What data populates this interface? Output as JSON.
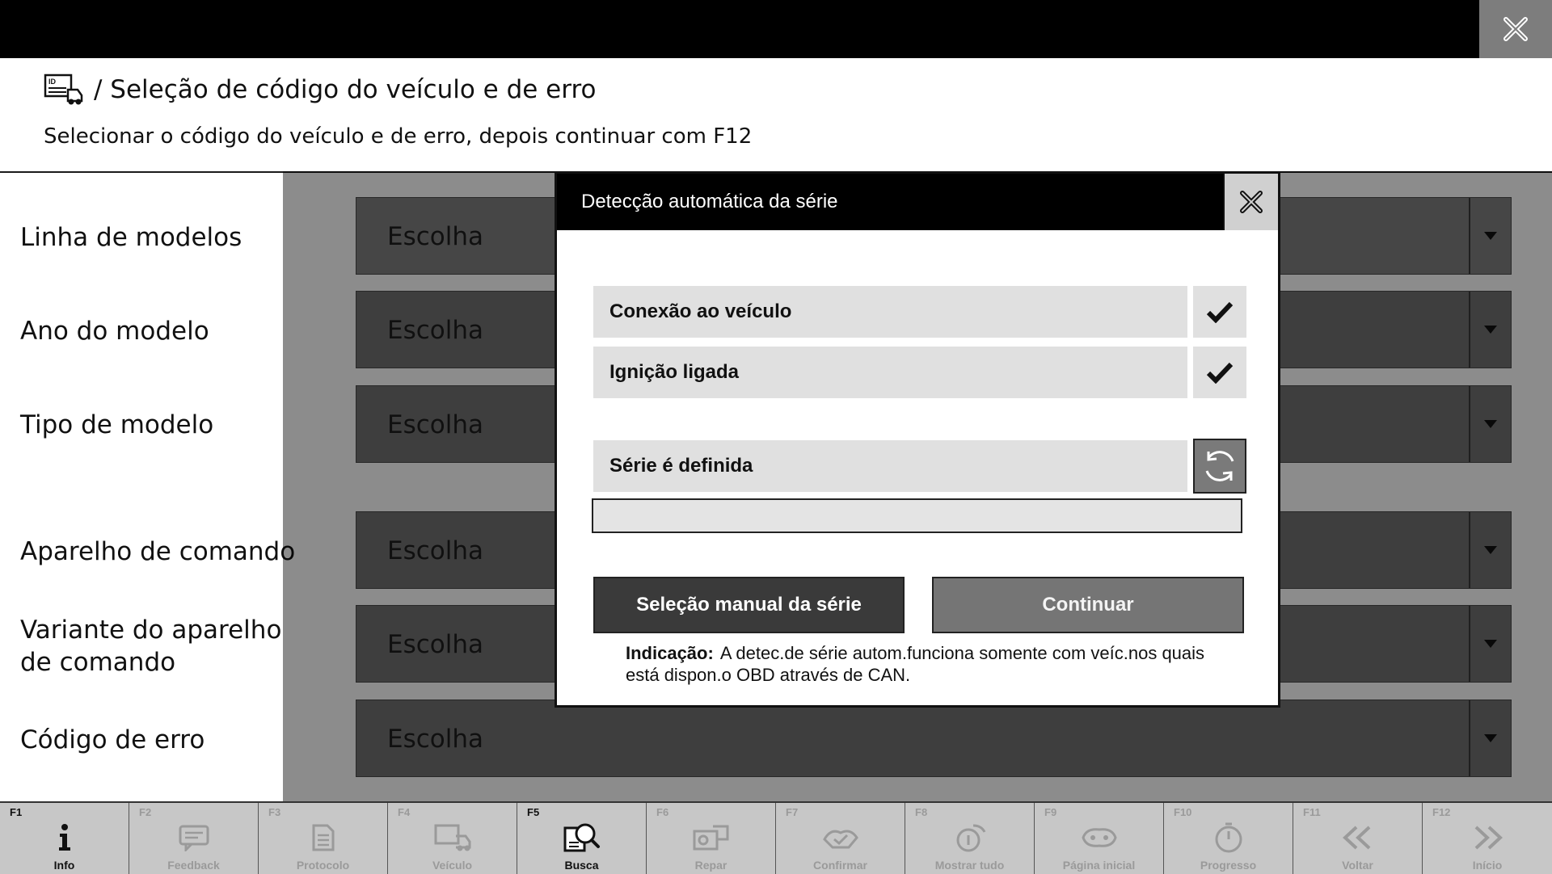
{
  "header": {
    "title": "/ Seleção de código do veículo e de erro",
    "subtitle": "Selecionar o código do veículo e de erro, depois continuar com F12"
  },
  "form": {
    "rows": [
      {
        "label": "Linha de modelos",
        "value": "Escolha"
      },
      {
        "label": "Ano do modelo",
        "value": "Escolha"
      },
      {
        "label": "Tipo de modelo",
        "value": "Escolha"
      },
      {
        "label": "Aparelho de comando",
        "value": "Escolha"
      },
      {
        "label": "Variante do aparelho de comando",
        "value": "Escolha"
      },
      {
        "label": "Código de erro",
        "value": "Escolha"
      }
    ]
  },
  "modal": {
    "title": "Detecção automática da série",
    "checks": [
      {
        "label": "Conexão ao veículo",
        "status": "done"
      },
      {
        "label": "Ignição ligada",
        "status": "done"
      }
    ],
    "series_status": {
      "label": "Série é definida",
      "status": "loading"
    },
    "progress_value": "",
    "manual_button": "Seleção manual da série",
    "continue_button": "Continuar",
    "hint_label": "Indicação:",
    "hint_text": "A detec.de série autom.funciona somente com veíc.nos quais está dispon.o OBD através de CAN."
  },
  "function_bar": [
    {
      "key": "F1",
      "label": "Info",
      "icon": "info-icon",
      "enabled": true
    },
    {
      "key": "F2",
      "label": "Feedback",
      "icon": "feedback-icon",
      "enabled": false
    },
    {
      "key": "F3",
      "label": "Protocolo",
      "icon": "protocol-icon",
      "enabled": false
    },
    {
      "key": "F4",
      "label": "Veículo",
      "icon": "vehicle-icon",
      "enabled": false
    },
    {
      "key": "F5",
      "label": "Busca",
      "icon": "search-icon",
      "enabled": true
    },
    {
      "key": "F6",
      "label": "Repar",
      "icon": "repair-icon",
      "enabled": false
    },
    {
      "key": "F7",
      "label": "Confirmar",
      "icon": "confirm-icon",
      "enabled": false
    },
    {
      "key": "F8",
      "label": "Mostrar tudo",
      "icon": "show-all-icon",
      "enabled": false
    },
    {
      "key": "F9",
      "label": "Página inicial",
      "icon": "home-icon",
      "enabled": false
    },
    {
      "key": "F10",
      "label": "Progresso",
      "icon": "progress-icon",
      "enabled": false
    },
    {
      "key": "F11",
      "label": "Voltar",
      "icon": "back-icon",
      "enabled": false
    },
    {
      "key": "F12",
      "label": "Início",
      "icon": "start-icon",
      "enabled": false
    }
  ],
  "colors": {
    "top_bar": "#000000",
    "field_bg": "#808080",
    "modal_header": "#000000",
    "primary_button": "#3a3a3a",
    "secondary_button": "#757575"
  }
}
